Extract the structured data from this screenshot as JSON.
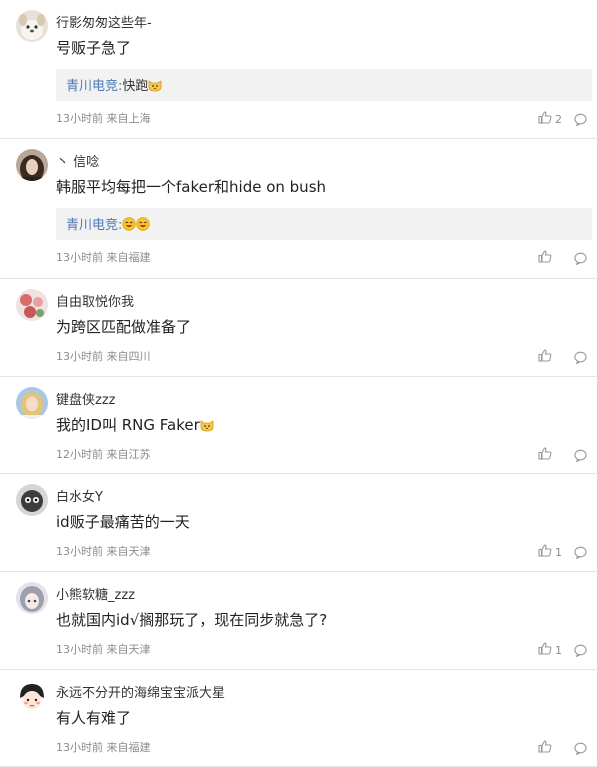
{
  "comments": [
    {
      "username": "行影匆匆这些年-",
      "text": "号贩子急了",
      "reply": {
        "name": "青川电竞:",
        "text": "快跑",
        "emoji": [
          "cat"
        ]
      },
      "meta": "13小时前 来自上海",
      "likes": "2",
      "avatar": "dog"
    },
    {
      "username": "丶 信唸",
      "text": "韩服平均每把一个faker和hide on bush",
      "reply": {
        "name": "青川电竞:",
        "text": "",
        "emoji": [
          "laugh",
          "laugh"
        ]
      },
      "meta": "13小时前 来自福建",
      "likes": "",
      "avatar": "girl-dark"
    },
    {
      "username": "自由取悦你我",
      "text": "为跨区匹配做准备了",
      "reply": null,
      "meta": "13小时前 来自四川",
      "likes": "",
      "avatar": "flowers"
    },
    {
      "username": "键盘侠zzz",
      "text": "我的ID叫 RNG Faker",
      "text_emoji": [
        "cat"
      ],
      "reply": null,
      "meta": "12小时前 来自江苏",
      "likes": "",
      "avatar": "blonde"
    },
    {
      "username": "白水女Y",
      "text": "id贩子最痛苦的一天",
      "reply": null,
      "meta": "13小时前 来自天津",
      "likes": "1",
      "avatar": "cartoon-dark"
    },
    {
      "username": "小熊软糖_zzz",
      "text": "也就国内id√搁那玩了，现在同步就急了?",
      "reply": null,
      "meta": "13小时前 来自天津",
      "likes": "1",
      "avatar": "anime"
    },
    {
      "username": "永远不分开的海绵宝宝派大星",
      "text": "有人有难了",
      "reply": null,
      "meta": "13小时前 来自福建",
      "likes": "",
      "avatar": "maruko"
    }
  ],
  "icons": {
    "like": "thumb-up-icon",
    "comment": "comment-bubble-icon"
  },
  "colors": {
    "reply_name": "#4a7ab5",
    "meta": "#8c8c8c",
    "divider": "#e6e6e6",
    "reply_bg": "#f2f2f2"
  }
}
